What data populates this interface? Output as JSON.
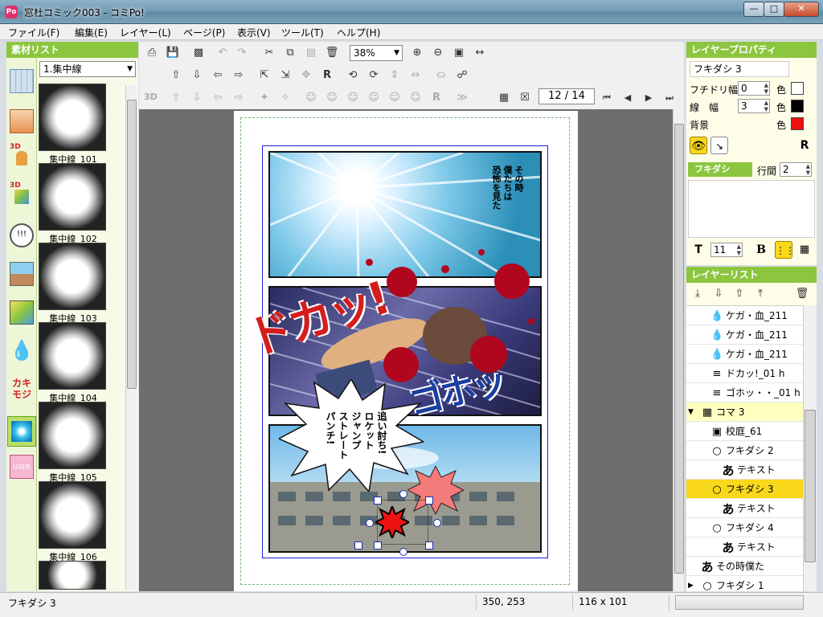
{
  "window": {
    "title": "窓杜コミック003 - コミPo!",
    "icon_text": "Po"
  },
  "menu": [
    "ファイル(F)",
    "編集(E)",
    "レイヤー(L)",
    "ページ(P)",
    "表示(V)",
    "ツール(T)",
    "ヘルプ(H)"
  ],
  "materials": {
    "header": "素材リスト",
    "category_select": "1.集中線",
    "category_icons": [
      "background-icon",
      "photo-background-icon",
      "3d-character-icon",
      "3d-object-icon",
      "speech-bubble-icon",
      "image-item-icon",
      "3d-cube-icon",
      "effect-drop-icon",
      "onomatopoeia-kakimoji-icon",
      "focus-lines-icon",
      "user-material-icon"
    ],
    "items": [
      "集中線_101",
      "集中線_102",
      "集中線_103",
      "集中線_104",
      "集中線_105",
      "集中線_106"
    ]
  },
  "toolbar": {
    "zoom": "38%",
    "label_3d": "3D",
    "page_indicator": "12 / 14"
  },
  "comic": {
    "narration": "その時\n僕たちは\n恐怖を見た",
    "sfx_1": "ドカッ!",
    "sfx_2": "ゴホッ",
    "bubble_text": "追い討ち!\nロケット\nジャンプ\nストレート\nパンチ!"
  },
  "properties": {
    "header": "レイヤープロパティ",
    "layer_name": "フキダシ 3",
    "border_width_label": "フチドリ幅",
    "border_width": "0",
    "line_width_label": "線　幅",
    "line_width": "3",
    "color_label": "色",
    "background_label": "背景",
    "colors": {
      "border": "#ffffff",
      "line": "#000000",
      "background": "#ee1111"
    },
    "fuki_tab": "フキダシ",
    "line_spacing_label": "行間",
    "line_spacing": "2",
    "font_size": "11",
    "bold_label": "B"
  },
  "layers": {
    "header": "レイヤーリスト",
    "rows": [
      {
        "label": "ケガ・血_211",
        "icon": "drop-icon",
        "indent": 2,
        "state": ""
      },
      {
        "label": "ケガ・血_211",
        "icon": "drop-icon",
        "indent": 2,
        "state": ""
      },
      {
        "label": "ケガ・血_211",
        "icon": "drop-icon",
        "indent": 2,
        "state": ""
      },
      {
        "label": "ドカッ!_01 h",
        "icon": "kakimoji-icon",
        "indent": 2,
        "state": ""
      },
      {
        "label": "ゴホッ・・_01 h",
        "icon": "kakimoji-icon",
        "indent": 2,
        "state": ""
      },
      {
        "label": "コマ 3",
        "icon": "panel-icon",
        "indent": 1,
        "state": "group"
      },
      {
        "label": "校庭_61",
        "icon": "image-icon",
        "indent": 2,
        "state": ""
      },
      {
        "label": "フキダシ 2",
        "icon": "bubble-icon",
        "indent": 2,
        "state": ""
      },
      {
        "label": "テキスト",
        "icon": "text-icon",
        "indent": 3,
        "state": ""
      },
      {
        "label": "フキダシ 3",
        "icon": "bubble-icon",
        "indent": 2,
        "state": "selected"
      },
      {
        "label": "テキスト",
        "icon": "text-icon",
        "indent": 3,
        "state": ""
      },
      {
        "label": "フキダシ 4",
        "icon": "bubble-icon",
        "indent": 2,
        "state": ""
      },
      {
        "label": "テキスト",
        "icon": "text-icon",
        "indent": 3,
        "state": ""
      },
      {
        "label": "その時僕た",
        "icon": "text-icon",
        "indent": 1,
        "state": ""
      },
      {
        "label": "フキダシ 1",
        "icon": "bubble-icon",
        "indent": 1,
        "state": "collapsed"
      }
    ]
  },
  "status": {
    "selected": "フキダシ 3",
    "position": "350, 253",
    "size": "116 x 101"
  }
}
